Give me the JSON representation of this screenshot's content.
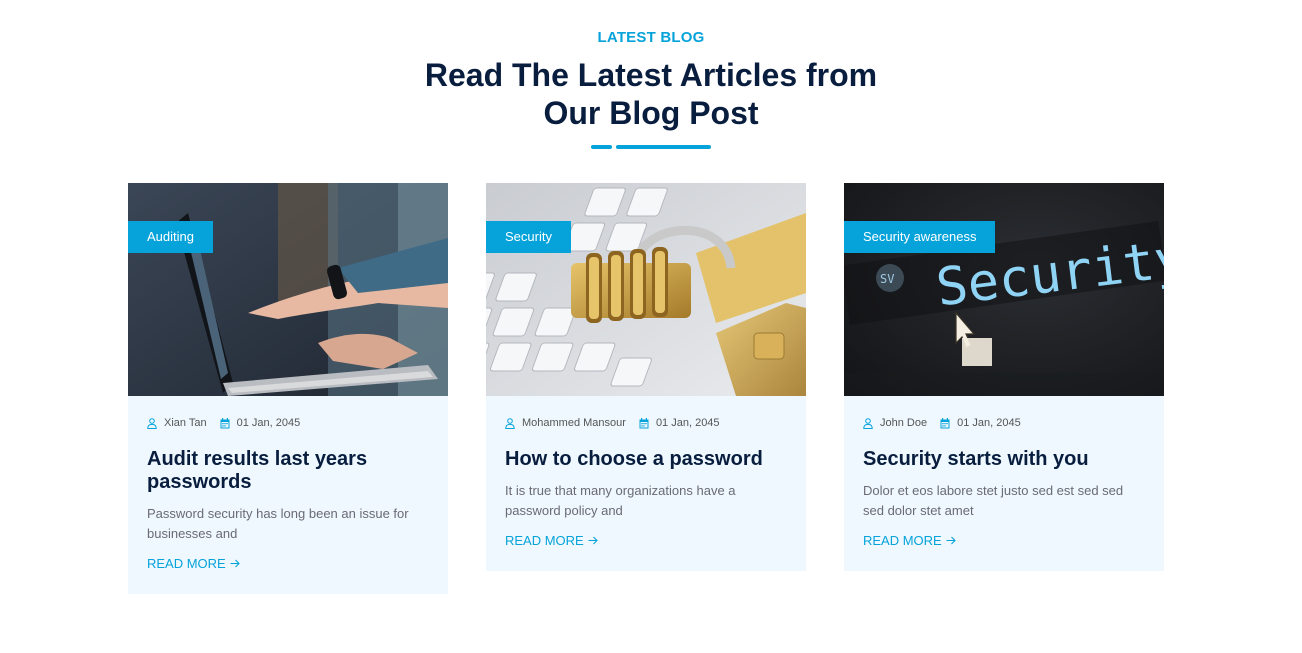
{
  "section": {
    "eyebrow": "LATEST BLOG",
    "heading_line1": "Read The Latest Articles from",
    "heading_line2": "Our Blog Post"
  },
  "posts": [
    {
      "category": "Auditing",
      "author": "Xian Tan",
      "date": "01 Jan, 2045",
      "title": "Audit results last years passwords",
      "excerpt": "Password security has long been an issue for businesses and",
      "read_more": "READ MORE"
    },
    {
      "category": "Security",
      "author": "Mohammed Mansour",
      "date": "01 Jan, 2045",
      "title": "How to choose a password",
      "excerpt": "It is true that many organizations have a password policy and",
      "read_more": "READ MORE"
    },
    {
      "category": "Security awareness",
      "author": "John Doe",
      "date": "01 Jan, 2045",
      "title": "Security starts with you",
      "excerpt": "Dolor et eos labore stet justo sed est sed sed sed dolor stet amet",
      "read_more": "READ MORE",
      "image_text": "Security"
    }
  ],
  "colors": {
    "accent": "#06a3da",
    "heading": "#091e3e",
    "card_bg": "#eef8fe"
  },
  "icons": {
    "author": "user-icon",
    "date": "calendar-icon",
    "read_more": "arrow-right-icon"
  }
}
